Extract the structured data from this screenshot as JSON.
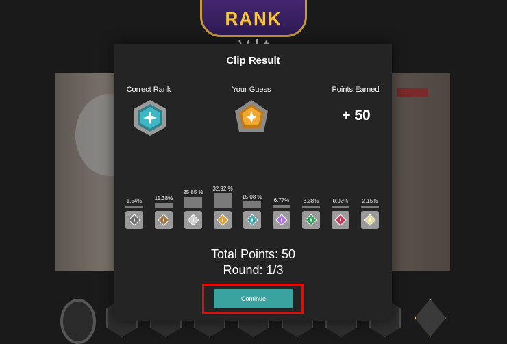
{
  "background": {
    "logo_text": "RANK",
    "title_partial": "V l   t"
  },
  "modal": {
    "title": "Clip Result",
    "correct_rank_label": "Correct Rank",
    "your_guess_label": "Your Guess",
    "points_earned_label": "Points Earned",
    "points_earned_value": "+ 50",
    "correct_rank_icon": "diamond-rank-icon",
    "guess_rank_icon": "gold-rank-icon",
    "distribution": [
      {
        "pct": "1.54%",
        "value": 1.54,
        "icon": "iron-rank-icon",
        "color": "#6e6e6e"
      },
      {
        "pct": "11.38%",
        "value": 11.38,
        "icon": "bronze-rank-icon",
        "color": "#a0703c"
      },
      {
        "pct": "25.85 %",
        "value": 25.85,
        "icon": "silver-rank-icon",
        "color": "#d0d0d0"
      },
      {
        "pct": "32.92 %",
        "value": 32.92,
        "icon": "gold-rank-icon",
        "color": "#e0a030"
      },
      {
        "pct": "15.08 %",
        "value": 15.08,
        "icon": "platinum-rank-icon",
        "color": "#3fa7b0"
      },
      {
        "pct": "6.77%",
        "value": 6.77,
        "icon": "diamond-rank-icon",
        "color": "#b070e0"
      },
      {
        "pct": "3.38%",
        "value": 3.38,
        "icon": "ascendant-rank-icon",
        "color": "#2f9e5a"
      },
      {
        "pct": "0.92%",
        "value": 0.92,
        "icon": "immortal-rank-icon",
        "color": "#c23a5a"
      },
      {
        "pct": "2.15%",
        "value": 2.15,
        "icon": "radiant-rank-icon",
        "color": "#e8d9a0"
      }
    ],
    "total_points": "Total Points: 50",
    "round": "Round: 1/3",
    "continue_label": "Continue"
  },
  "colors": {
    "accent": "#3aa3a0",
    "highlight_frame": "#e00d0d",
    "modal_bg": "#242424"
  }
}
